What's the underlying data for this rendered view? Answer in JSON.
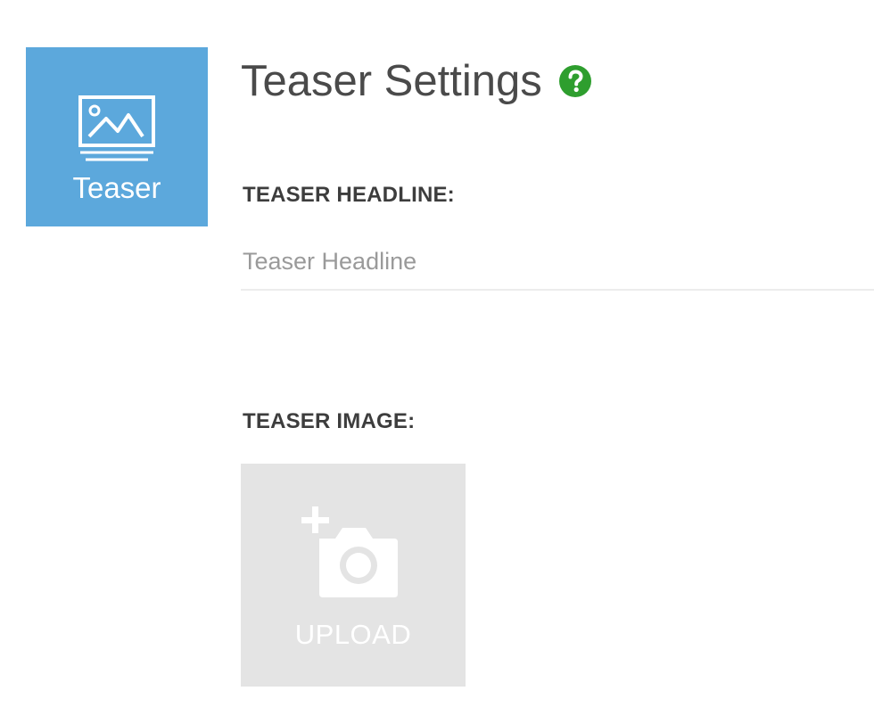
{
  "sidebar": {
    "tile_label": "Teaser",
    "tile_icon": "image-icon",
    "tile_color": "#5ca8dc"
  },
  "header": {
    "title": "Teaser Settings",
    "help_icon": "question-circle-icon",
    "help_color": "#2e9e2e"
  },
  "form": {
    "headline_label": "TEASER HEADLINE:",
    "headline_placeholder": "Teaser Headline",
    "headline_value": "",
    "image_label": "TEASER IMAGE:",
    "upload_label": "UPLOAD",
    "upload_icon": "camera-plus-icon"
  }
}
